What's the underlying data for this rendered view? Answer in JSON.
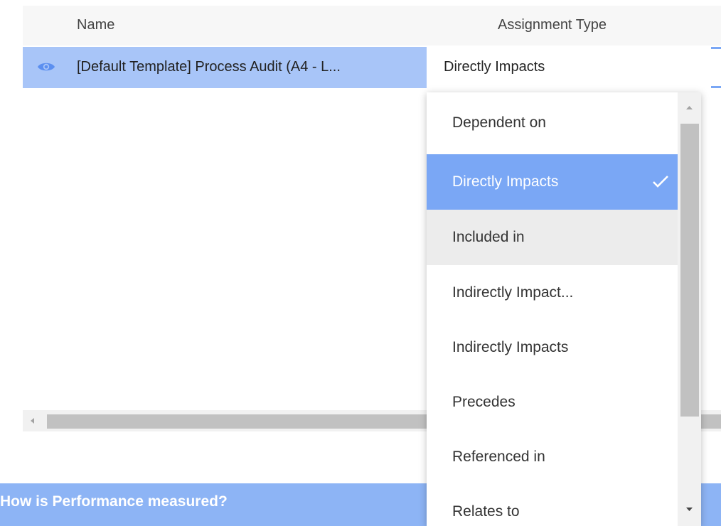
{
  "table": {
    "columns": {
      "name": "Name",
      "assignment_type": "Assignment Type"
    },
    "rows": [
      {
        "name": "[Default Template] Process Audit (A4 - L...",
        "assignment_type": "Directly Impacts"
      }
    ]
  },
  "dropdown": {
    "options": [
      {
        "label": "Dependent on"
      },
      {
        "label": "Directly Impacts",
        "selected": true
      },
      {
        "label": "Included in",
        "hovered": true
      },
      {
        "label": "Indirectly Impact..."
      },
      {
        "label": "Indirectly Impacts"
      },
      {
        "label": "Precedes"
      },
      {
        "label": "Referenced in"
      },
      {
        "label": "Relates to"
      }
    ]
  },
  "section": {
    "title": "How is Performance measured?"
  },
  "icons": {
    "row_icon": "eye-icon",
    "selected_marker": "check-icon",
    "scroll_up": "arrow-up-icon",
    "scroll_down": "arrow-down-icon",
    "scroll_left": "arrow-left-icon"
  },
  "colors": {
    "selected_row": "#a8c5f8",
    "selected_option": "#7aa7f5",
    "hovered_option": "#ececec",
    "section_bar": "#8db4f5",
    "eye_icon": "#5b8ff0"
  }
}
